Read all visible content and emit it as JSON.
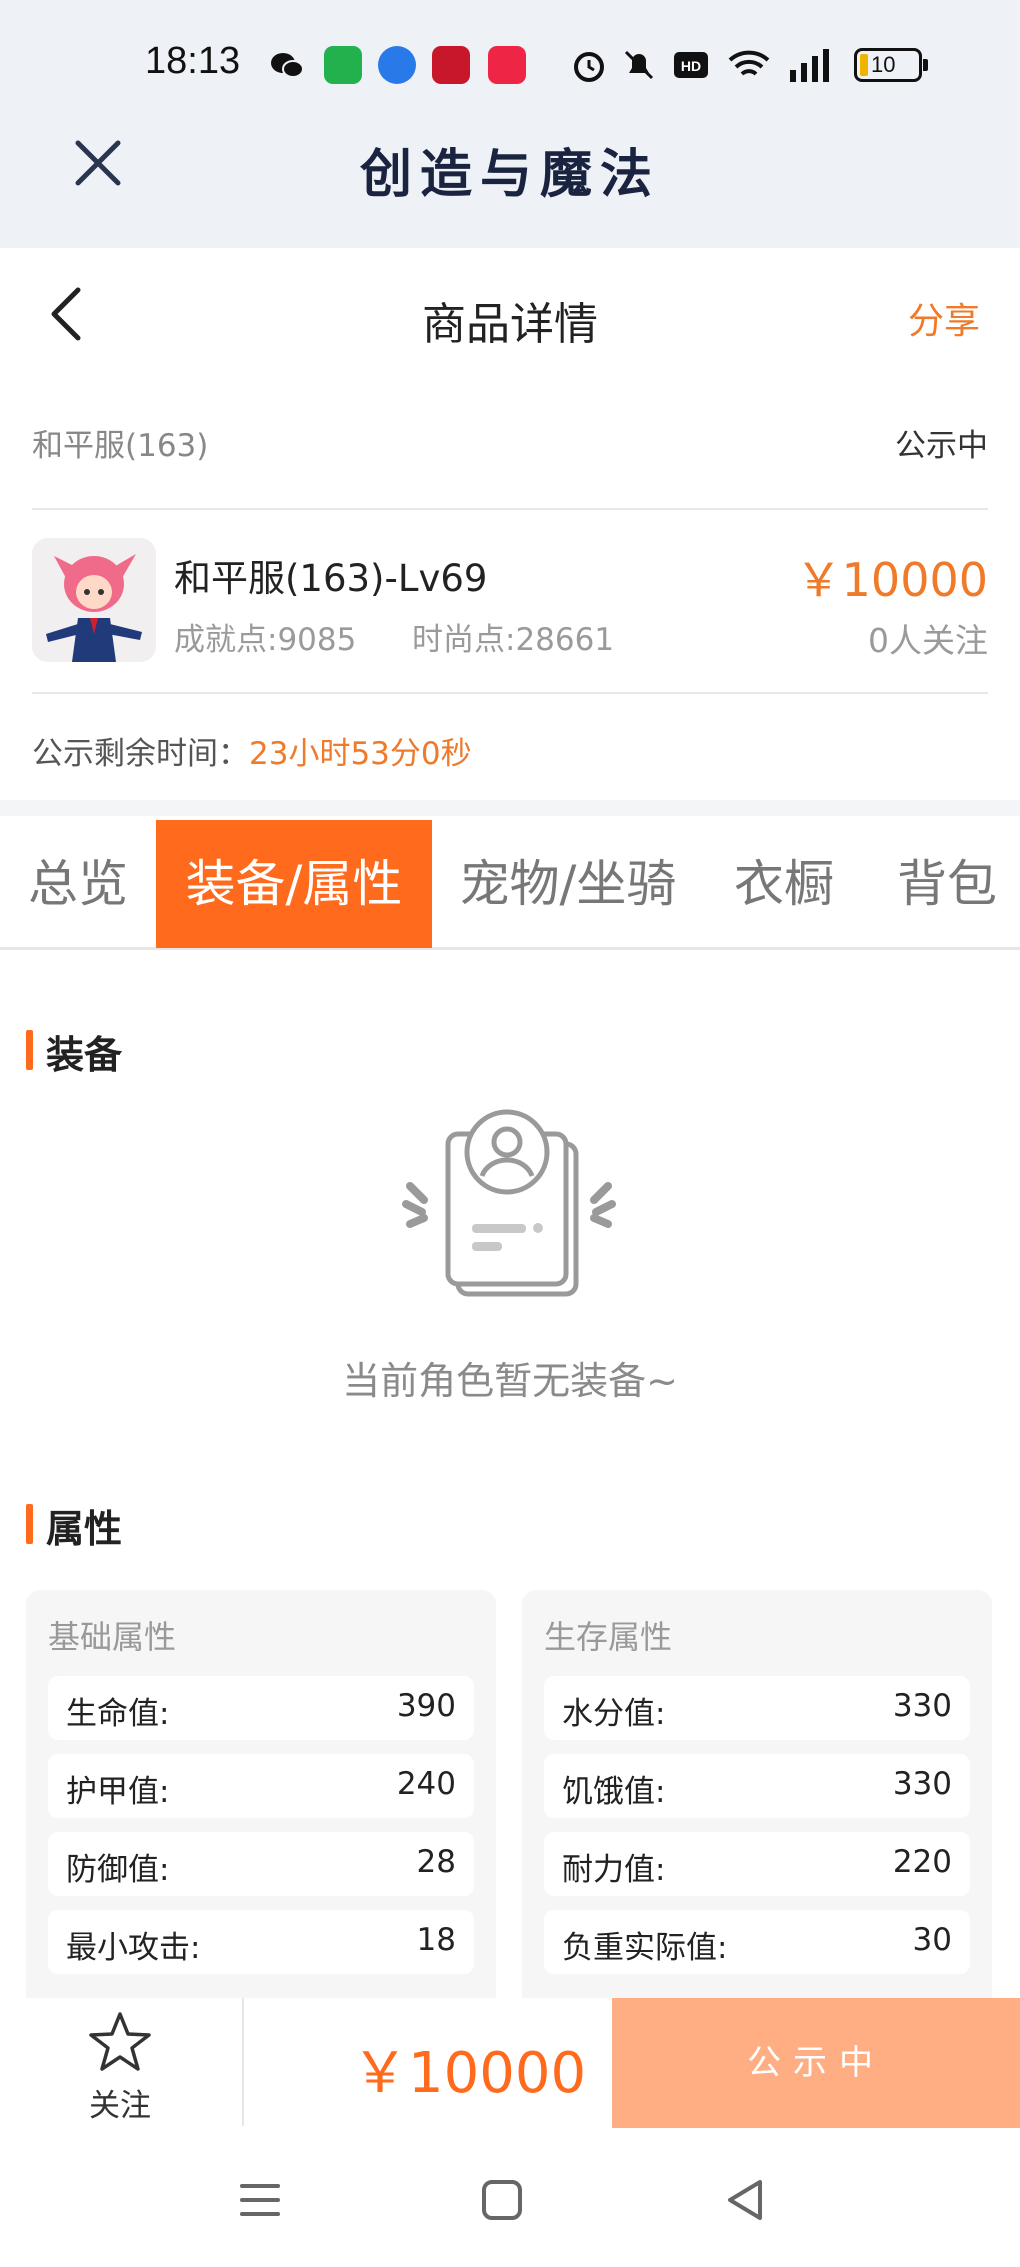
{
  "status_bar": {
    "time": "18:13",
    "battery": "10",
    "network": "4G",
    "icons": [
      "wechat-icon",
      "app-green-icon",
      "app-blue-icon",
      "app-red-icon",
      "xiaohongshu-icon",
      "alarm-icon",
      "mute-icon",
      "hd-icon",
      "wifi-icon",
      "signal-icon",
      "battery-icon"
    ]
  },
  "app_bar": {
    "title": "创造与魔法"
  },
  "header": {
    "title": "商品详情",
    "share_label": "分享"
  },
  "server_row": {
    "server": "和平服(163)",
    "status": "公示中"
  },
  "product": {
    "name": "和平服(163)-Lv69",
    "achievement": "成就点:9085",
    "fashion": "时尚点:28661",
    "price": "￥10000",
    "followers": "0人关注"
  },
  "remaining": {
    "label": "公示剩余时间：",
    "value": "23小时53分0秒"
  },
  "tabs": [
    {
      "label": "总览",
      "active": false
    },
    {
      "label": "装备/属性",
      "active": true
    },
    {
      "label": "宠物/坐骑",
      "active": false
    },
    {
      "label": "衣橱",
      "active": false
    },
    {
      "label": "背包",
      "active": false
    }
  ],
  "equipment": {
    "title": "装备",
    "empty_text": "当前角色暂无装备~"
  },
  "attributes": {
    "title": "属性",
    "basic": {
      "title": "基础属性",
      "rows": [
        {
          "key": "生命值:",
          "value": "390"
        },
        {
          "key": "护甲值:",
          "value": "240"
        },
        {
          "key": "防御值:",
          "value": "28"
        },
        {
          "key": "最小攻击:",
          "value": "18"
        }
      ]
    },
    "survival": {
      "title": "生存属性",
      "rows": [
        {
          "key": "水分值:",
          "value": "330"
        },
        {
          "key": "饥饿值:",
          "value": "330"
        },
        {
          "key": "耐力值:",
          "value": "220"
        },
        {
          "key": "负重实际值:",
          "value": "30"
        }
      ]
    }
  },
  "bottom_bar": {
    "follow_label": "关注",
    "price": "￥10000",
    "action_label": "公示中"
  },
  "colors": {
    "accent": "#ff6a1c",
    "accent_text": "#ee7a2a",
    "button_disabled": "#ffae84",
    "app_title": "#1a2340"
  }
}
